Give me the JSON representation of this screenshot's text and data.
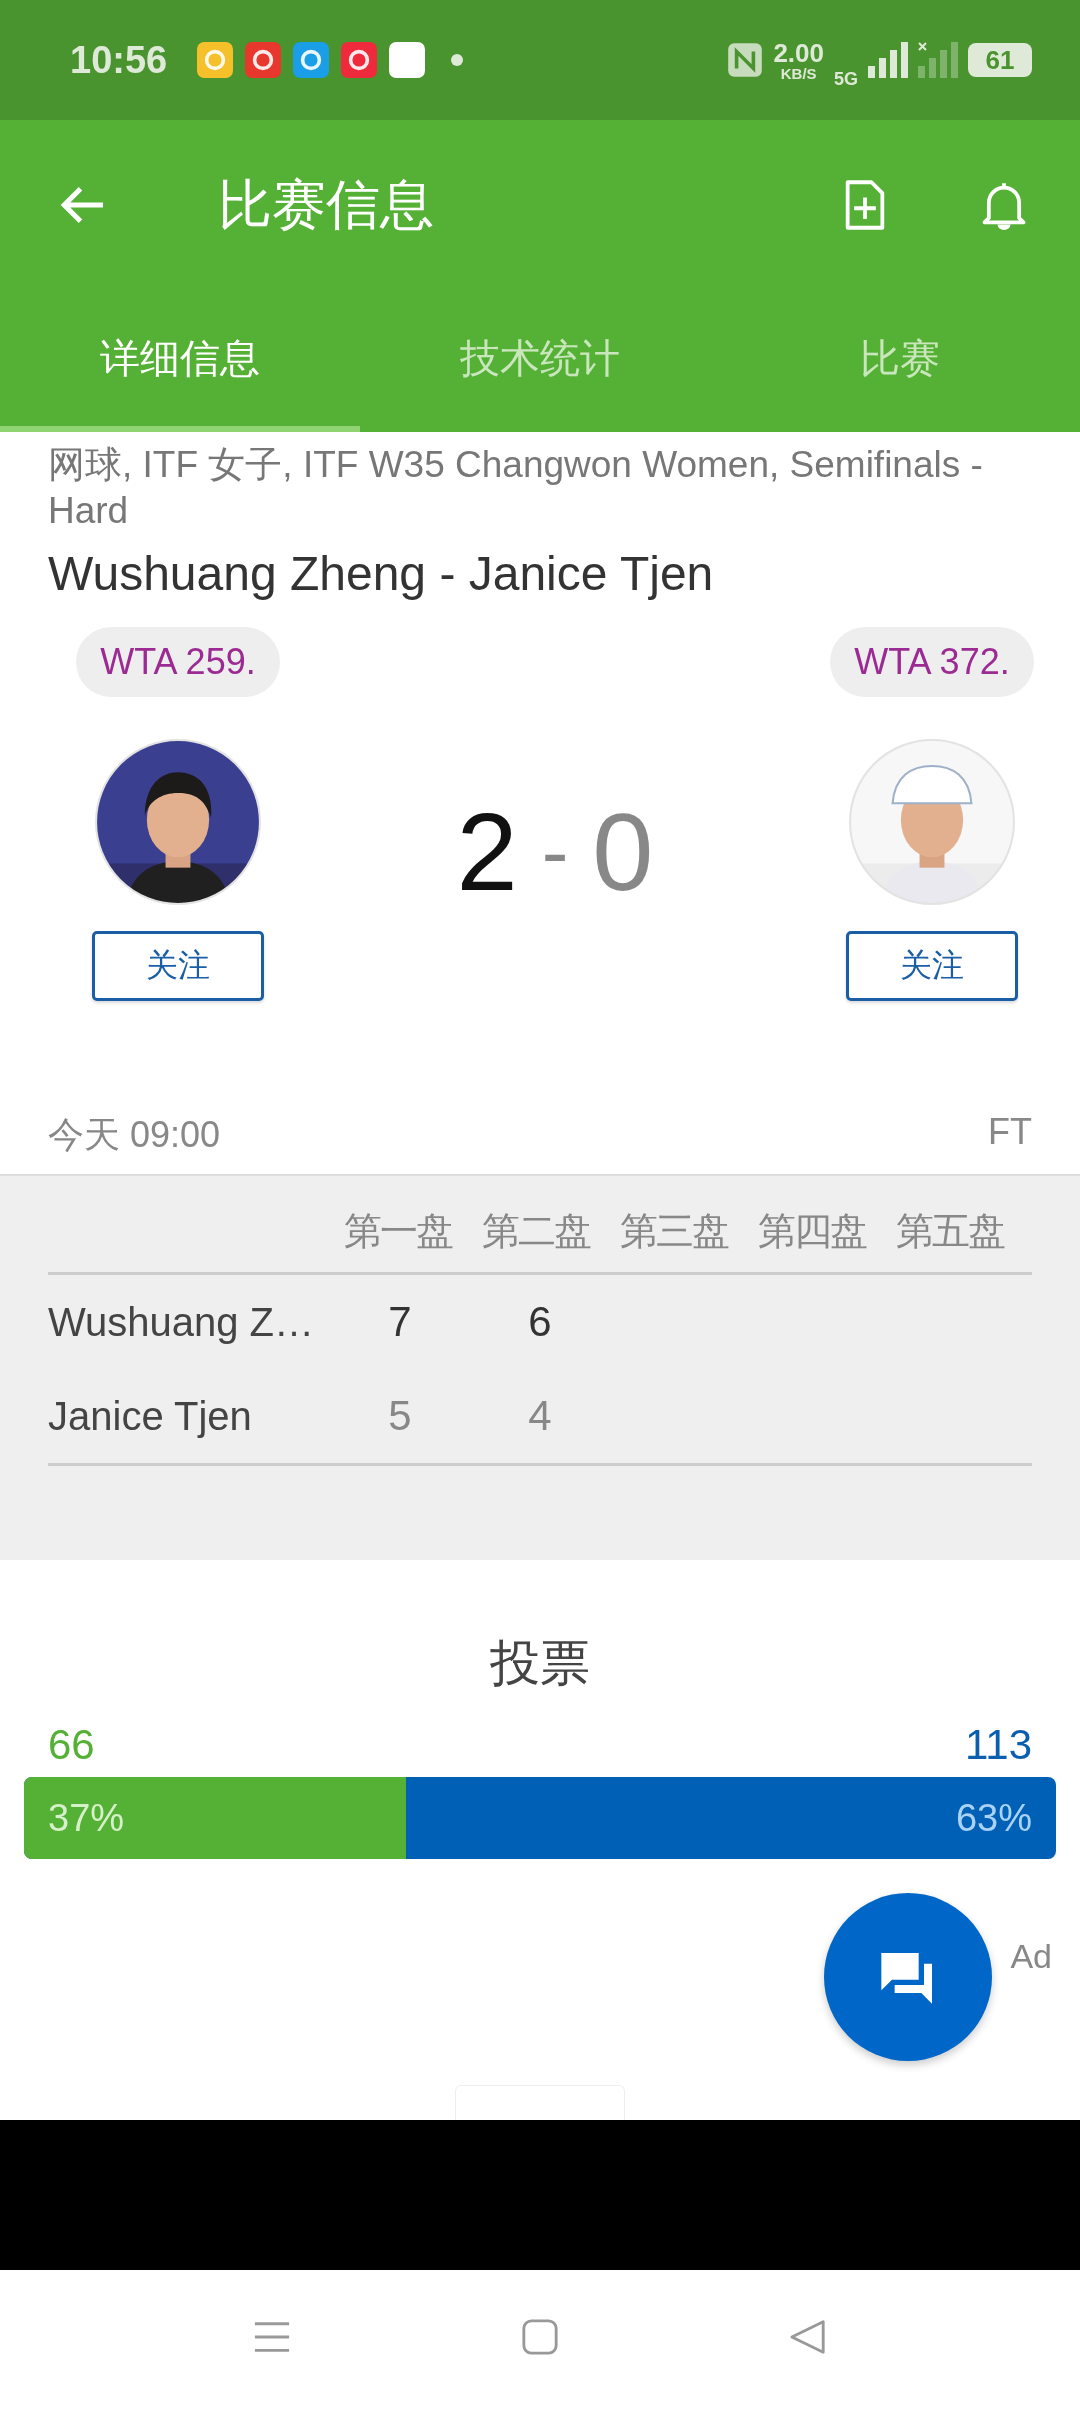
{
  "status_bar": {
    "time": "10:56",
    "notification_apps": [
      {
        "color": "#f5c02a"
      },
      {
        "color": "#e8372d"
      },
      {
        "color": "#1a9ee8"
      },
      {
        "color": "#ee2a3c"
      },
      {
        "color": "#ffffff"
      }
    ],
    "speed": "2.00",
    "speed_unit": "KB/S",
    "network": "5G",
    "battery": "61"
  },
  "app_bar": {
    "title": "比赛信息"
  },
  "tabs": [
    {
      "label": "详细信息",
      "selected": true
    },
    {
      "label": "技术统计",
      "selected": false
    },
    {
      "label": "比赛",
      "selected": false
    }
  ],
  "match": {
    "competition": "网球, ITF 女子, ITF W35 Changwon Women, Semifinals - Hard",
    "title": "Wushuang Zheng - Janice Tjen",
    "players": [
      {
        "rank": "WTA 259.",
        "follow": "关注",
        "winner": true
      },
      {
        "rank": "WTA 372.",
        "follow": "关注",
        "winner": false
      }
    ],
    "score_home": "2",
    "score_separator": "-",
    "score_away": "0",
    "time": "今天 09:00",
    "status": "FT"
  },
  "sets": {
    "columns": [
      "第一盘",
      "第二盘",
      "第三盘",
      "第四盘",
      "第五盘"
    ],
    "rows": [
      {
        "name": "Wushuang Z…",
        "winner": true,
        "scores": [
          "7",
          "6"
        ]
      },
      {
        "name": "Janice Tjen",
        "winner": false,
        "scores": [
          "5",
          "4"
        ]
      }
    ]
  },
  "vote": {
    "title": "投票",
    "home_count": "66",
    "away_count": "113",
    "home_percent": "37%",
    "away_percent": "63%",
    "level": 0.37
  },
  "ad_label": "Ad"
}
